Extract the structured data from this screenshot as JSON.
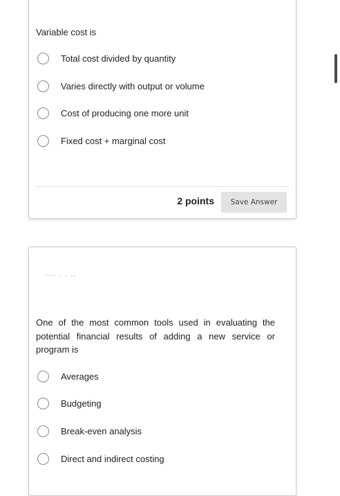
{
  "question1": {
    "text": "Variable cost is",
    "options": [
      "Total cost divided by quantity",
      "Varies directly with output or volume",
      "Cost of producing one more unit",
      "Fixed cost + marginal cost"
    ],
    "points": "2 points",
    "save_label": "Save Answer"
  },
  "question2": {
    "faint_text": "····  -  · --",
    "text": "One of the most common tools used in evaluating the potential financial results of adding a new service or program is",
    "options": [
      "Averages",
      "Budgeting",
      "Break-even analysis",
      "Direct and indirect costing"
    ]
  }
}
